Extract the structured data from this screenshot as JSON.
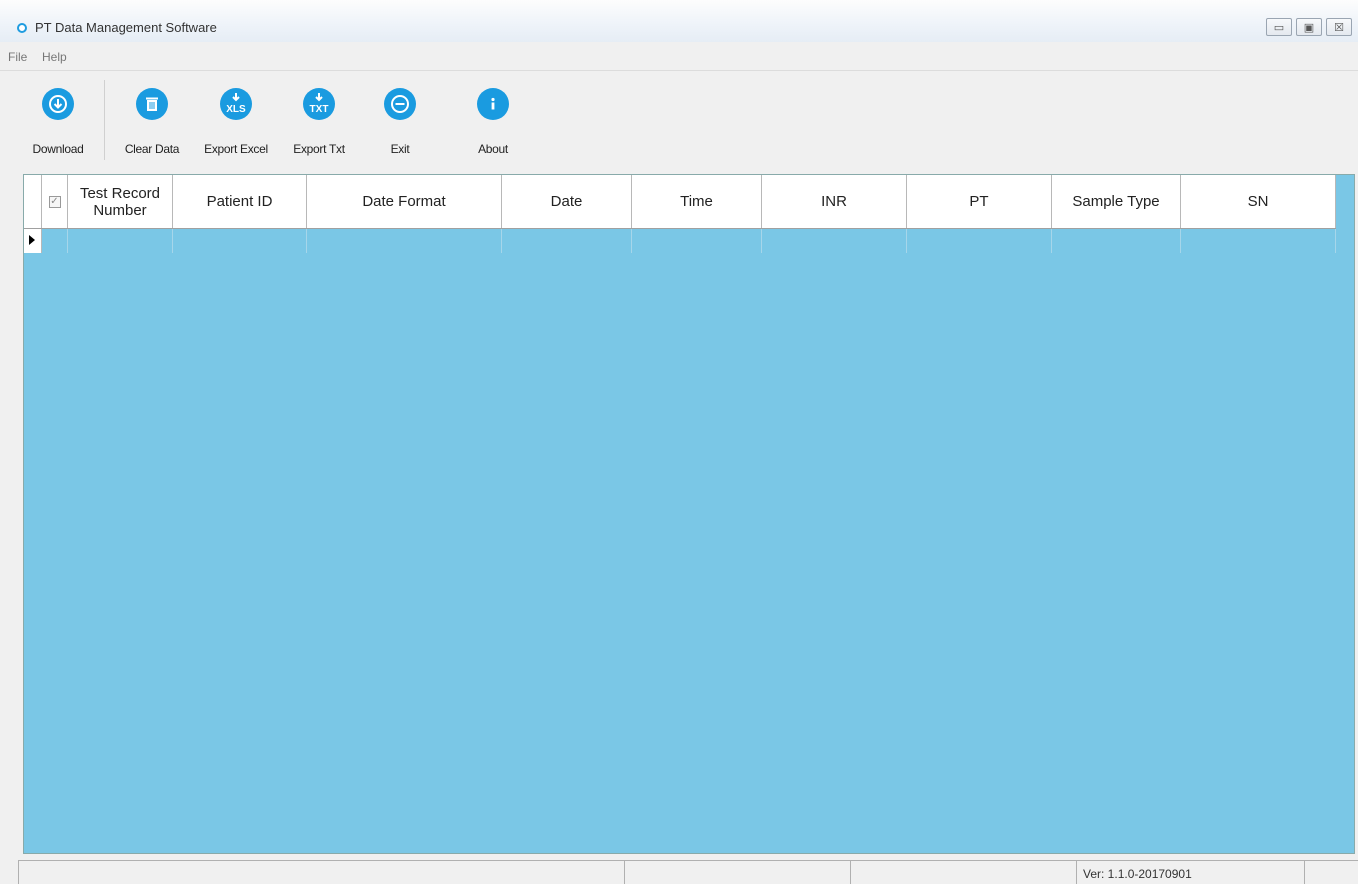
{
  "window": {
    "title": "PT Data Management Software",
    "controls": [
      "▭",
      "▣",
      "☒"
    ]
  },
  "menu": {
    "file": "File",
    "help": "Help"
  },
  "toolbar": {
    "download": "Download",
    "clear_data": "Clear Data",
    "export_excel": "Export Excel",
    "export_txt": "Export Txt",
    "exit": "Exit",
    "about": "About",
    "icon_color": "#1a9be0"
  },
  "grid": {
    "columns": {
      "test_record_number": "Test Record Number",
      "patient_id": "Patient ID",
      "date_format": "Date Format",
      "date": "Date",
      "time": "Time",
      "inr": "INR",
      "pt": "PT",
      "sample_type": "Sample Type",
      "sn": "SN"
    },
    "background_color": "#7ac7e6"
  },
  "status": {
    "version": "Ver: 1.1.0-20170901"
  }
}
